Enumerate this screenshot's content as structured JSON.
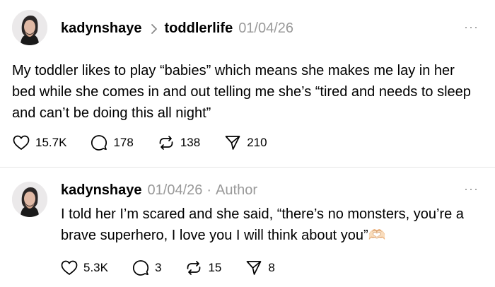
{
  "post": {
    "username": "kadynshaye",
    "topic": "toddlerlife",
    "date": "01/04/26",
    "more": "···",
    "text": "My toddler likes to play “babies” which means she makes me lay in her bed while she comes in and out telling me she’s “tired and needs to sleep and can’t be doing this all night”",
    "likes": "15.7K",
    "replies": "178",
    "reposts": "138",
    "shares": "210"
  },
  "reply": {
    "username": "kadynshaye",
    "date": "01/04/26",
    "separator": "·",
    "author_label": "Author",
    "more": "···",
    "text": "I told her I’m scared and she said, “there’s no monsters, you’re a brave superhero, I love you I will think about you”🫶🏻",
    "likes": "5.3K",
    "replies": "3",
    "reposts": "15",
    "shares": "8"
  },
  "icons": [
    "heart-icon",
    "comment-icon",
    "repost-icon",
    "send-icon",
    "more-icon",
    "chevron-right-icon"
  ]
}
